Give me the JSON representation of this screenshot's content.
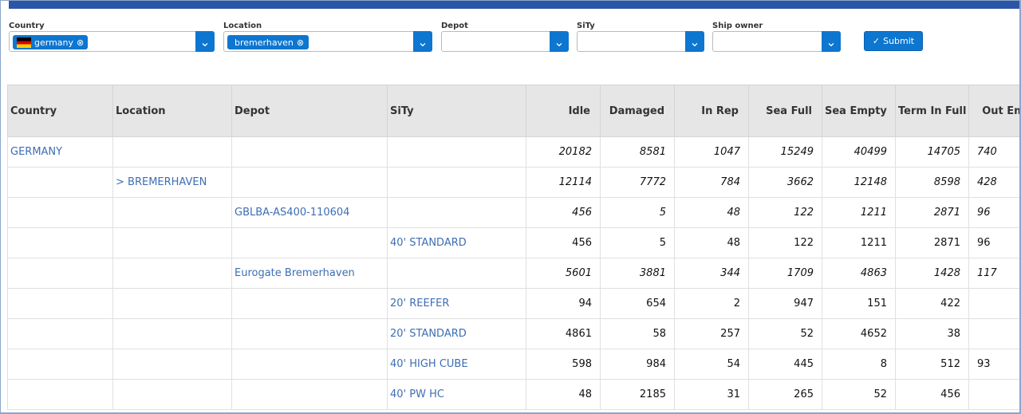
{
  "filters": {
    "country": {
      "label": "Country",
      "chip": "germany",
      "flag": "germany-flag"
    },
    "location": {
      "label": "Location",
      "chip": "bremerhaven"
    },
    "depot": {
      "label": "Depot"
    },
    "sity": {
      "label": "SiTy"
    },
    "ship_owner": {
      "label": "Ship owner"
    },
    "submit_label": "Submit"
  },
  "colors": {
    "accent": "#0d76d0",
    "topbar": "#2b55a6",
    "link": "#3d6eb4"
  },
  "table": {
    "headers": [
      "Country",
      "Location",
      "Depot",
      "SiTy",
      "Idle",
      "Damaged",
      "In Rep",
      "Sea Full",
      "Sea Empty",
      "Term In Full",
      "Out Emp"
    ],
    "rows": [
      {
        "country": "GERMANY",
        "location": "",
        "depot": "",
        "sity": "",
        "values": [
          "20182",
          "8581",
          "1047",
          "15249",
          "40499",
          "14705",
          "740"
        ],
        "italic": true
      },
      {
        "country": "",
        "location": "> BREMERHAVEN",
        "depot": "",
        "sity": "",
        "values": [
          "12114",
          "7772",
          "784",
          "3662",
          "12148",
          "8598",
          "428"
        ],
        "italic": true
      },
      {
        "country": "",
        "location": "",
        "depot": "GBLBA-AS400-110604",
        "sity": "",
        "values": [
          "456",
          "5",
          "48",
          "122",
          "1211",
          "2871",
          "96"
        ],
        "italic": true
      },
      {
        "country": "",
        "location": "",
        "depot": "",
        "sity": "40' STANDARD",
        "values": [
          "456",
          "5",
          "48",
          "122",
          "1211",
          "2871",
          "96"
        ],
        "italic": false
      },
      {
        "country": "",
        "location": "",
        "depot": "Eurogate Bremerhaven",
        "sity": "",
        "values": [
          "5601",
          "3881",
          "344",
          "1709",
          "4863",
          "1428",
          "117"
        ],
        "italic": true
      },
      {
        "country": "",
        "location": "",
        "depot": "",
        "sity": "20' REEFER",
        "values": [
          "94",
          "654",
          "2",
          "947",
          "151",
          "422",
          ""
        ],
        "italic": false
      },
      {
        "country": "",
        "location": "",
        "depot": "",
        "sity": "20' STANDARD",
        "values": [
          "4861",
          "58",
          "257",
          "52",
          "4652",
          "38",
          ""
        ],
        "italic": false
      },
      {
        "country": "",
        "location": "",
        "depot": "",
        "sity": "40' HIGH CUBE",
        "values": [
          "598",
          "984",
          "54",
          "445",
          "8",
          "512",
          "93"
        ],
        "italic": false
      },
      {
        "country": "",
        "location": "",
        "depot": "",
        "sity": "40' PW HC",
        "values": [
          "48",
          "2185",
          "31",
          "265",
          "52",
          "456",
          ""
        ],
        "italic": false
      }
    ]
  }
}
